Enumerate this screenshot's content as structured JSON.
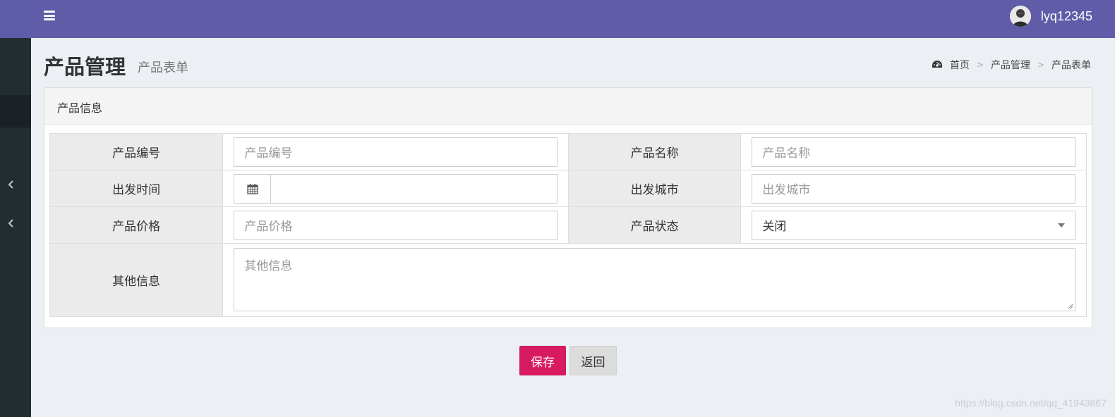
{
  "header": {
    "username": "lyq12345"
  },
  "page": {
    "title": "产品管理",
    "subtitle": "产品表单"
  },
  "breadcrumb": {
    "home": "首页",
    "sep": ">",
    "level1": "产品管理",
    "level2": "产品表单"
  },
  "box": {
    "title": "产品信息"
  },
  "form": {
    "product_num_label": "产品编号",
    "product_num_placeholder": "产品编号",
    "product_name_label": "产品名称",
    "product_name_placeholder": "产品名称",
    "depart_time_label": "出发时间",
    "depart_time_value": "",
    "depart_city_label": "出发城市",
    "depart_city_placeholder": "出发城市",
    "price_label": "产品价格",
    "price_placeholder": "产品价格",
    "status_label": "产品状态",
    "status_value": "关闭",
    "desc_label": "其他信息",
    "desc_placeholder": "其他信息"
  },
  "buttons": {
    "save": "保存",
    "back": "返回"
  },
  "watermark": "https://blog.csdn.net/qq_41943867",
  "colors": {
    "header": "#605ca8",
    "sidebar": "#222d32",
    "save_button": "#d81b60",
    "back_button": "#dcdcdc"
  }
}
